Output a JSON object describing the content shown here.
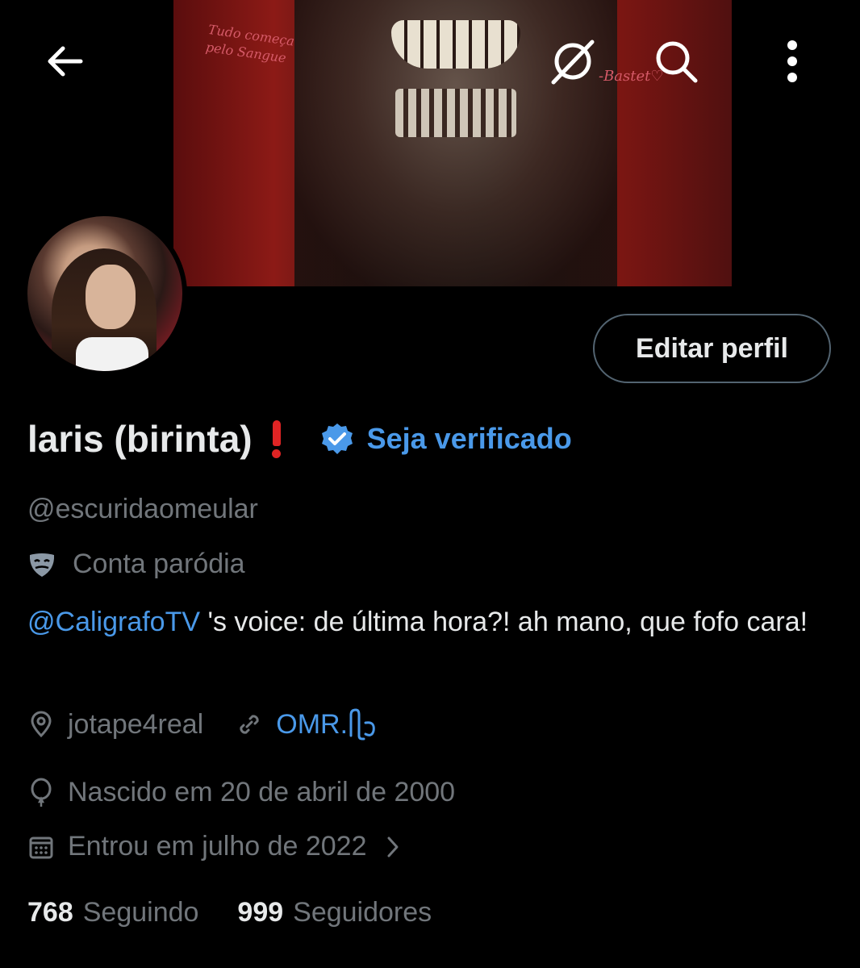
{
  "banner": {
    "script_text": "Tudo começa pelo Sangue",
    "signature": "-Bastet♡"
  },
  "header": {
    "back_icon": "arrow-left-icon",
    "grok_icon": "grok-icon",
    "search_icon": "search-icon",
    "more_icon": "more-vertical-icon"
  },
  "profile": {
    "edit_button": "Editar perfil",
    "display_name": "laris (birinta)",
    "name_emoji": "exclamation-mark-emoji",
    "verify_label": "Seja verificado",
    "handle": "@escuridaomeular",
    "parody_label": "Conta paródia",
    "bio_mention": "@CaligrafoTV",
    "bio_text": " 's voice: de última hora?! ah mano, que fofo cara!",
    "location": "jotape4real",
    "website": "OMR.",
    "birth": "Nascido em 20 de abril de 2000",
    "joined": "Entrou em julho de 2022",
    "following_count": "768",
    "following_label": "Seguindo",
    "followers_count": "999",
    "followers_label": "Seguidores"
  },
  "colors": {
    "accent": "#4a99e9",
    "muted": "#71767b",
    "text": "#e7e9ea",
    "background": "#000000"
  }
}
